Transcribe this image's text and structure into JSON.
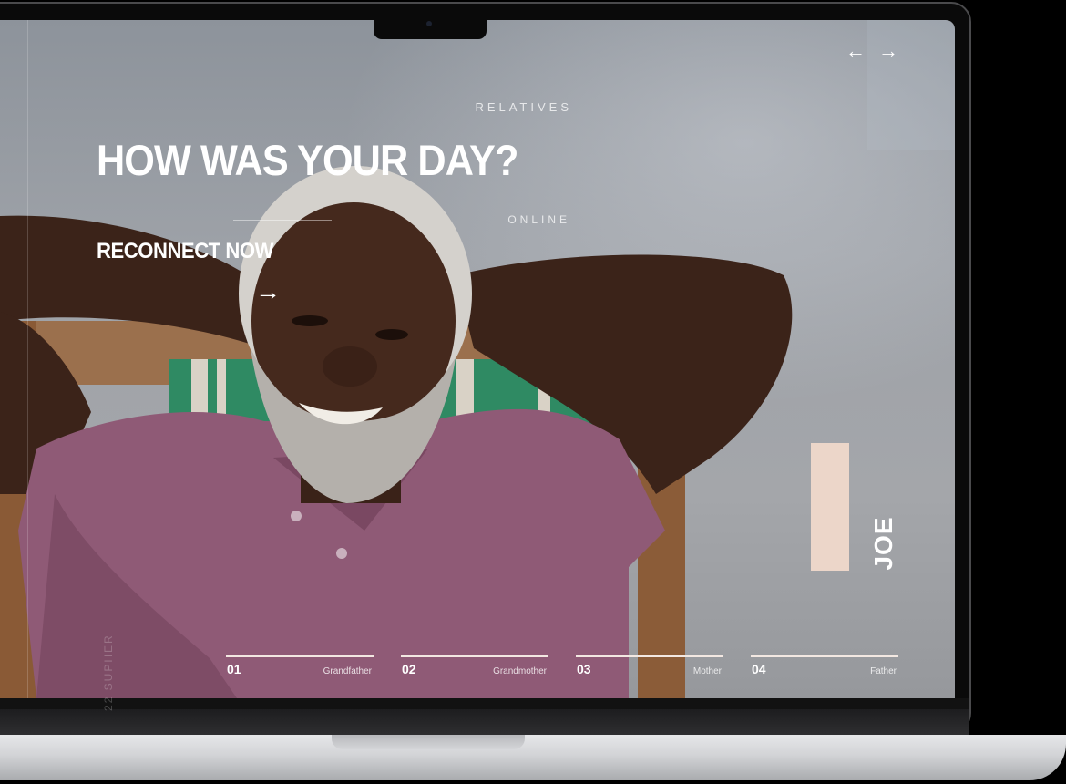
{
  "hero": {
    "eyebrow": "RELATIVES",
    "headline": "HOW WAS YOUR DAY?",
    "status": "ONLINE",
    "cta_label": "RECONNECT NOW"
  },
  "featured": {
    "name": "JOE"
  },
  "relatives": [
    {
      "number": "01",
      "role": "Grandfather"
    },
    {
      "number": "02",
      "role": "Grandmother"
    },
    {
      "number": "03",
      "role": "Mother"
    },
    {
      "number": "04",
      "role": "Father"
    }
  ],
  "icons": {
    "prev": "arrow-left-icon",
    "next": "arrow-right-icon",
    "cta": "arrow-right-icon"
  },
  "watermark": "22 SUPHER",
  "colors": {
    "accent": "#ecd6c9",
    "shirt": "#8f5a76",
    "chair_fabric": "#2f8a63",
    "background": "#9ea2a8"
  }
}
